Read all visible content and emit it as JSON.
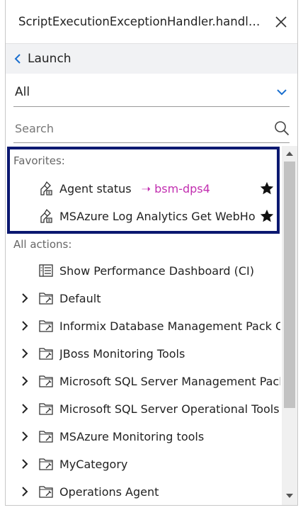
{
  "header": {
    "title": "ScriptExecutionExceptionHandler.handleException"
  },
  "nav": {
    "back_label": "Launch"
  },
  "filter": {
    "value": "All"
  },
  "search": {
    "placeholder": "Search",
    "value": ""
  },
  "favorites": {
    "label": "Favorites:",
    "items": [
      {
        "label": "Agent status",
        "target": "bsm-dps4"
      },
      {
        "label": "MSAzure Log Analytics Get WebHook"
      }
    ]
  },
  "all_actions": {
    "label": "All actions:",
    "items": [
      {
        "label": "Show Performance Dashboard (CI)",
        "icon": "dashboard-icon"
      },
      {
        "label": "Default",
        "icon": "folder-tool-icon"
      },
      {
        "label": "Informix Database Management Pack Operations",
        "icon": "folder-tool-icon"
      },
      {
        "label": "JBoss Monitoring Tools",
        "icon": "folder-tool-icon"
      },
      {
        "label": "Microsoft SQL Server Management Pack",
        "icon": "folder-tool-icon"
      },
      {
        "label": "Microsoft SQL Server Operational Tools",
        "icon": "folder-tool-icon"
      },
      {
        "label": "MSAzure Monitoring tools",
        "icon": "folder-tool-icon"
      },
      {
        "label": "MyCategory",
        "icon": "folder-tool-icon"
      },
      {
        "label": "Operations Agent",
        "icon": "folder-tool-icon"
      }
    ]
  },
  "colors": {
    "accent": "#1a6fcf",
    "target": "#c22fb0",
    "highlight_border": "#0b1870"
  }
}
